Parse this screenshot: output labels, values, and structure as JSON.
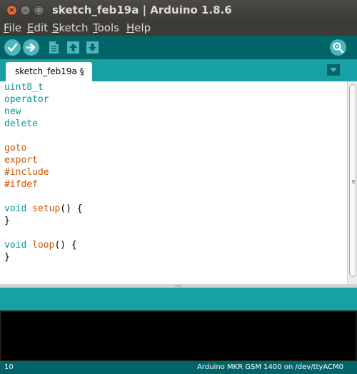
{
  "window": {
    "title": "sketch_feb19a | Arduino 1.8.6",
    "close_glyph": "×",
    "minimize_glyph": "–",
    "maximize_glyph": "□"
  },
  "menu": {
    "items": [
      "File",
      "Edit",
      "Sketch",
      "Tools",
      "Help"
    ]
  },
  "toolbar": {
    "icons": [
      "verify-icon",
      "upload-icon",
      "new-icon",
      "open-icon",
      "save-icon",
      "serial-monitor-icon"
    ]
  },
  "tabs": {
    "active": "sketch_feb19a §"
  },
  "editor": {
    "lines": {
      "l1": "uint8_t",
      "l2": "operator",
      "l3": "new",
      "l4": "delete",
      "l6": "goto",
      "l7": "export",
      "l8": "#include",
      "l9": "#ifdef",
      "l11_kw": "void",
      "l11_fn": "setup",
      "l11_rest": "() {",
      "l12": "}",
      "l14_kw": "void",
      "l14_fn": "loop",
      "l14_rest": "() {",
      "l15": "}"
    }
  },
  "status": {
    "line_number": "10",
    "board": "Arduino MKR GSM 1400 on /dev/ttyACM0"
  },
  "colors": {
    "toolbar": "#006468",
    "tabbar": "#17a1a5",
    "button": "#4db7bb",
    "keyword_teal": "#00979c",
    "keyword_orange": "#d35400"
  }
}
